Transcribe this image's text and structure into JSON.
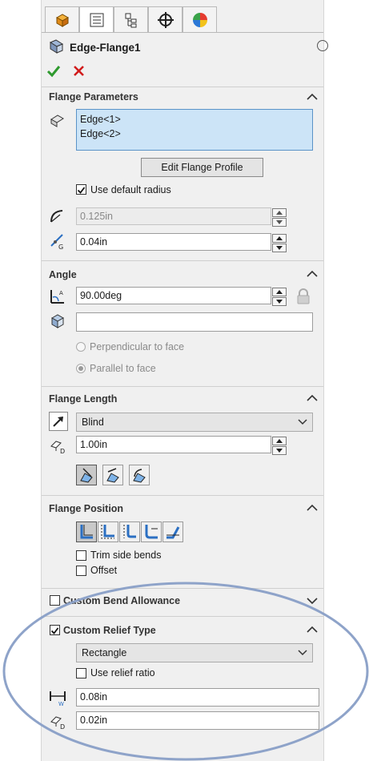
{
  "tabs": [
    {
      "name": "feature-manager-icon"
    },
    {
      "name": "property-manager-icon"
    },
    {
      "name": "configuration-manager-icon"
    },
    {
      "name": "dimxpert-manager-icon"
    },
    {
      "name": "display-manager-icon"
    }
  ],
  "feature": {
    "title": "Edge-Flange1",
    "ok_icon": "check-icon",
    "cancel_icon": "x-icon",
    "help_icon": "help-icon"
  },
  "flange_parameters": {
    "header": "Flange Parameters",
    "edges": [
      "Edge<1>",
      "Edge<2>"
    ],
    "edit_profile_button": "Edit Flange Profile",
    "use_default_radius_label": "Use default radius",
    "use_default_radius_checked": true,
    "radius_value": "0.125in",
    "gap_value": "0.04in"
  },
  "angle": {
    "header": "Angle",
    "angle_value": "90.00deg",
    "face_value": "",
    "perpendicular_label": "Perpendicular to face",
    "parallel_label": "Parallel to face",
    "selected": "parallel"
  },
  "flange_length": {
    "header": "Flange Length",
    "end_condition": "Blind",
    "length_value": "1.00in"
  },
  "flange_position": {
    "header": "Flange Position",
    "trim_side_bends_label": "Trim side bends",
    "offset_label": "Offset"
  },
  "custom_bend_allowance": {
    "label": "Custom Bend Allowance",
    "checked": false
  },
  "custom_relief_type": {
    "label": "Custom Relief Type",
    "checked": true,
    "relief_type": "Rectangle",
    "use_relief_ratio_label": "Use relief ratio",
    "width_value": "0.08in",
    "depth_value": "0.02in"
  },
  "colors": {
    "accent_selection": "#cce4f7",
    "highlight_ellipse": "#8ea3c9",
    "ok_green": "#2e9a2e",
    "cancel_red": "#d11b1b"
  }
}
